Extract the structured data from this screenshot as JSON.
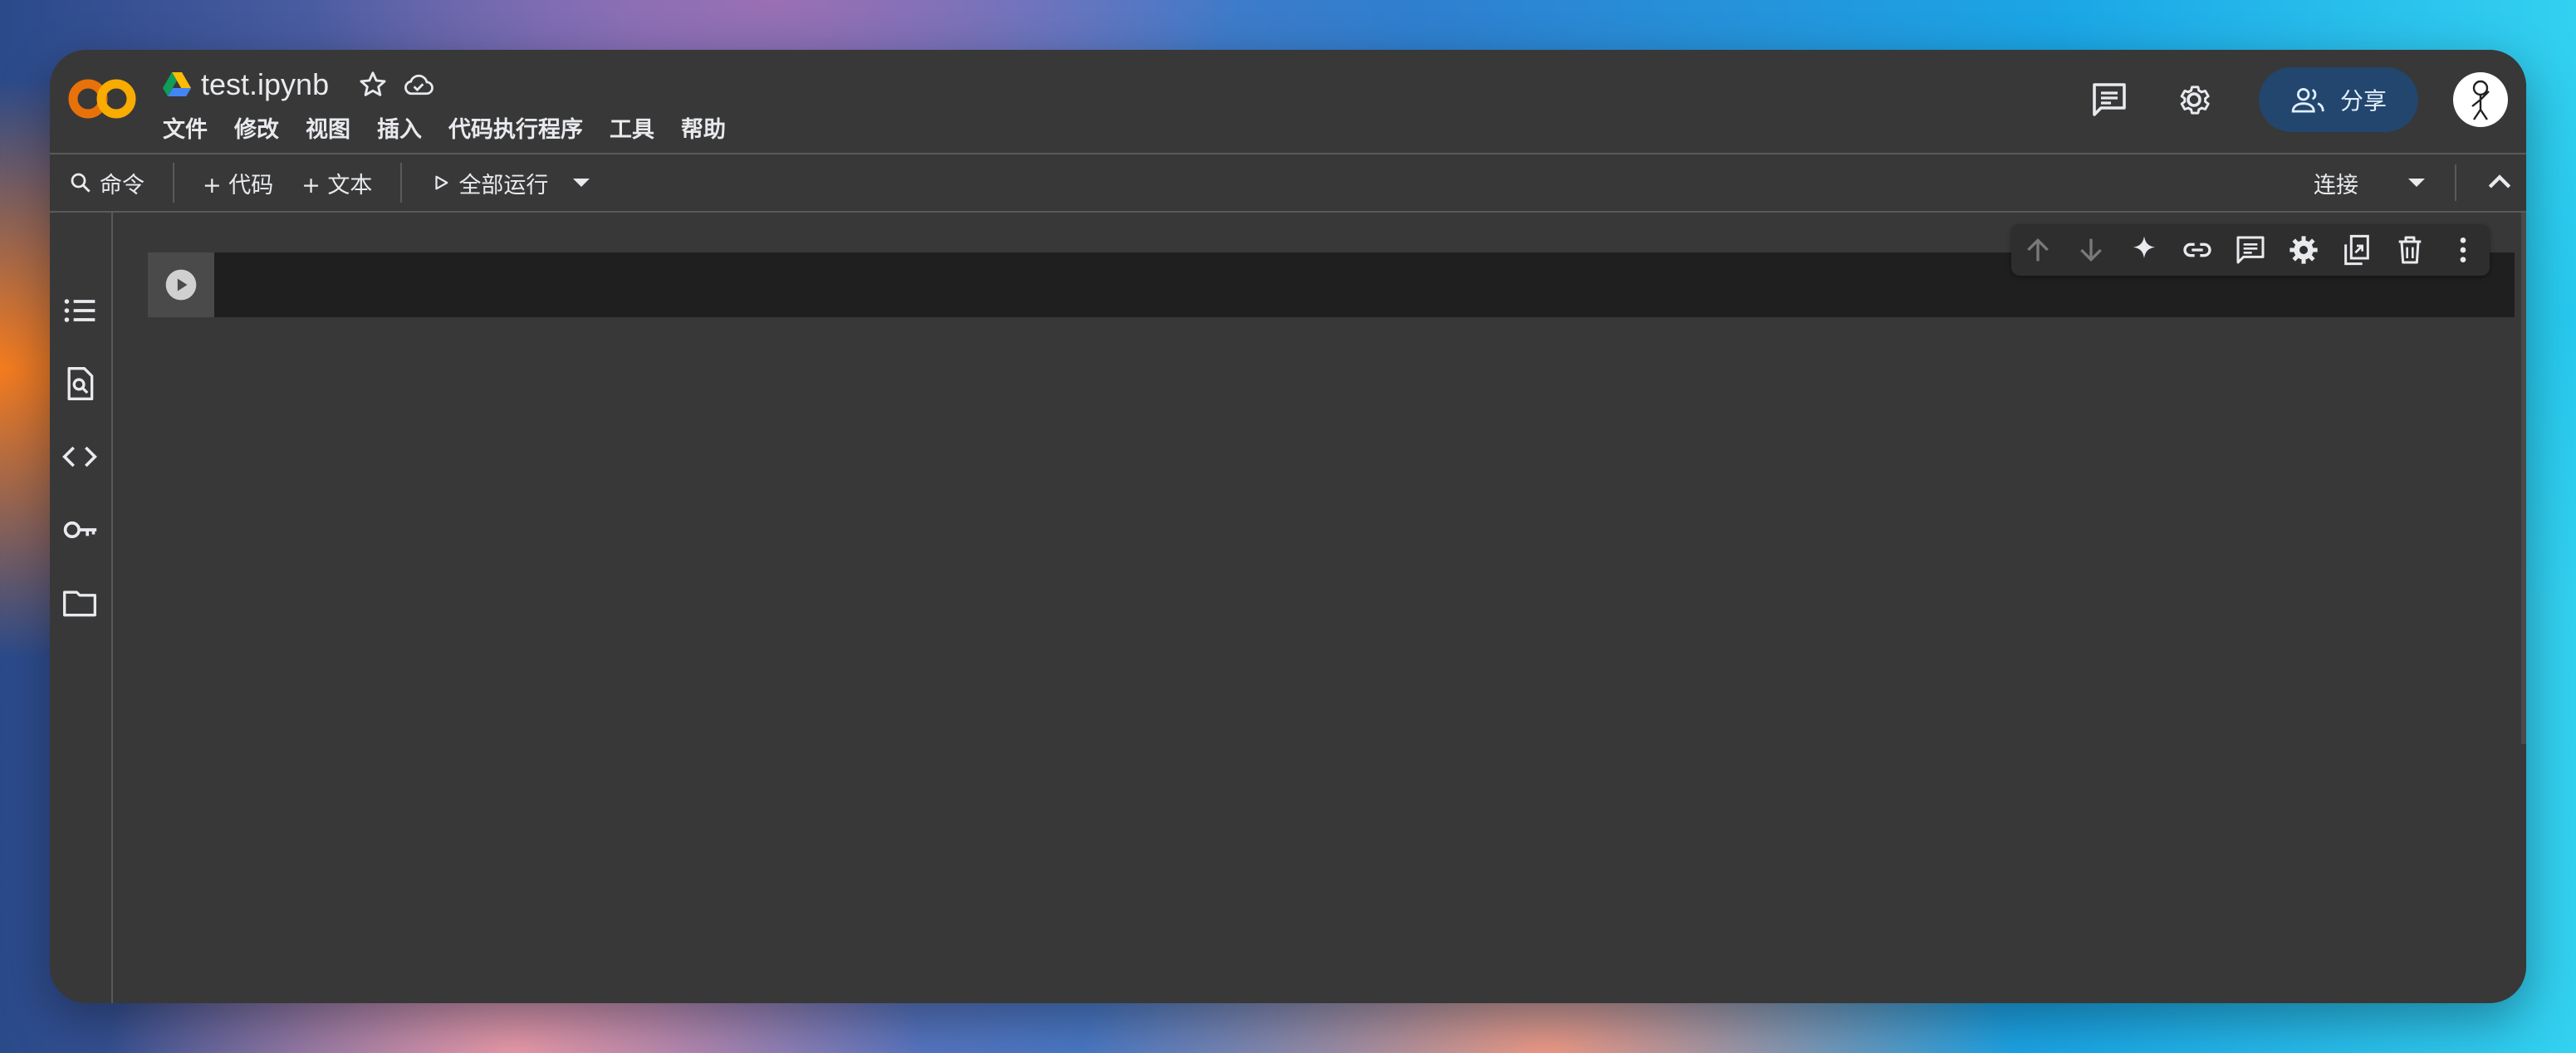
{
  "colors": {
    "window_bg": "#383838",
    "cell_bg": "#1f1f1f",
    "share_bg": "#22466d",
    "text": "#e8eaed",
    "logo_orange": "#f9ab00",
    "logo_dark_orange": "#e8710a"
  },
  "header": {
    "logo_icon": "colab-logo",
    "file_title": "test.ipynb",
    "drive_icon": "google-drive-icon",
    "star_icon": "star-outline-icon",
    "cloud_icon": "cloud-saved-icon",
    "menu": [
      "文件",
      "修改",
      "视图",
      "插入",
      "代码执行程序",
      "工具",
      "帮助"
    ],
    "comment_icon": "comment-icon",
    "settings_icon": "gear-icon",
    "share_label": "分享",
    "share_icon": "people-icon",
    "avatar_icon": "user-avatar"
  },
  "toolbar": {
    "command_label": "命令",
    "add_code_label": "+ 代码",
    "add_text_label": "+ 文本",
    "run_all_label": "全部运行",
    "connect_label": "连接"
  },
  "sidebar": {
    "items": [
      "table-of-contents-icon",
      "find-replace-icon",
      "code-snippets-icon",
      "secrets-key-icon",
      "folder-icon"
    ]
  },
  "cell": {
    "code": "",
    "toolbar_icons": [
      "arrow-up-icon",
      "arrow-down-icon",
      "sparkle-icon",
      "link-icon",
      "comment-icon",
      "gear-icon",
      "mirror-cell-icon",
      "trash-icon",
      "more-vert-icon"
    ]
  }
}
